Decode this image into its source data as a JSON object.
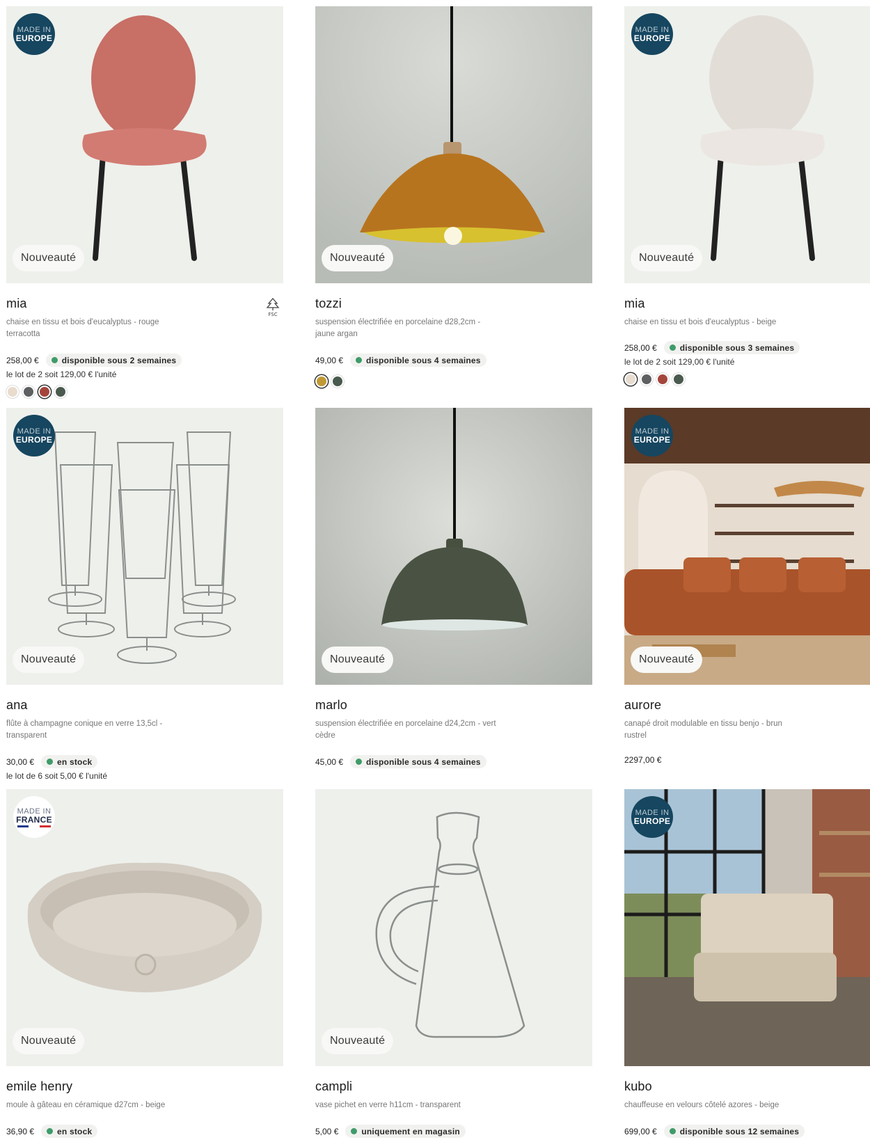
{
  "products": [
    {
      "title": "mia",
      "desc": "chaise en tissu et bois d'eucalyptus - rouge terracotta",
      "price": "258,00 €",
      "availability": "disponible sous 2 semaines",
      "lot": "le lot de 2 soit 129,00 € l'unité",
      "badge": "Nouveauté",
      "origin_l1": "MADE IN",
      "origin_l2": "EUROPE",
      "swatches": [
        "#e9dccd",
        "#5d5f60",
        "#a4453c",
        "#4a5a4f"
      ],
      "selected_swatch": 2
    },
    {
      "title": "tozzi",
      "desc": "suspension électrifiée en porcelaine d28,2cm - jaune argan",
      "price": "49,00 €",
      "availability": "disponible sous 4 semaines",
      "lot": "",
      "badge": "Nouveauté",
      "origin_l1": "",
      "origin_l2": "",
      "swatches": [
        "#c19a36",
        "#495a4e"
      ],
      "selected_swatch": 0
    },
    {
      "title": "mia",
      "desc": "chaise en tissu et bois d'eucalyptus - beige",
      "price": "258,00 €",
      "availability": "disponible sous 3 semaines",
      "lot": "le lot de 2 soit 129,00 € l'unité",
      "badge": "Nouveauté",
      "origin_l1": "MADE IN",
      "origin_l2": "EUROPE",
      "swatches": [
        "#e7dccf",
        "#5d5f60",
        "#a4453c",
        "#4a5a4f"
      ],
      "selected_swatch": 0
    },
    {
      "title": "ana",
      "desc": "flûte à champagne conique en verre 13,5cl - transparent",
      "price": "30,00 €",
      "availability": "en stock",
      "lot": "le lot de 6 soit 5,00 € l'unité",
      "badge": "Nouveauté",
      "origin_l1": "MADE IN",
      "origin_l2": "EUROPE"
    },
    {
      "title": "marlo",
      "desc": "suspension électrifiée en porcelaine d24,2cm - vert cèdre",
      "price": "45,00 €",
      "availability": "disponible sous 4 semaines",
      "lot": "",
      "badge": "Nouveauté",
      "origin_l1": "",
      "origin_l2": ""
    },
    {
      "title": "aurore",
      "desc": "canapé droit modulable en tissu benjo - brun rustrel",
      "price": "2297,00 €",
      "availability": "",
      "lot": "",
      "badge": "Nouveauté",
      "origin_l1": "MADE IN",
      "origin_l2": "EUROPE"
    },
    {
      "title": "emile henry",
      "desc": "moule à gâteau en céramique d27cm - beige",
      "price": "36,90 €",
      "availability": "en stock",
      "lot": "",
      "badge": "Nouveauté",
      "origin_l1": "MADE IN",
      "origin_l2": "FRANCE"
    },
    {
      "title": "campli",
      "desc": "vase pichet en verre h11cm - transparent",
      "price": "5,00 €",
      "availability": "uniquement en magasin",
      "lot": "",
      "badge": "Nouveauté",
      "origin_l1": "",
      "origin_l2": ""
    },
    {
      "title": "kubo",
      "desc": "chauffeuse en velours côtelé azores - beige",
      "price": "699,00 €",
      "availability": "disponible sous 12 semaines",
      "lot": "",
      "badge": "",
      "origin_l1": "MADE IN",
      "origin_l2": "EUROPE"
    }
  ],
  "fsc_label": "FSC",
  "colors": {
    "availability_dot": "#3f9b6a",
    "origin_badge": "#164660"
  }
}
